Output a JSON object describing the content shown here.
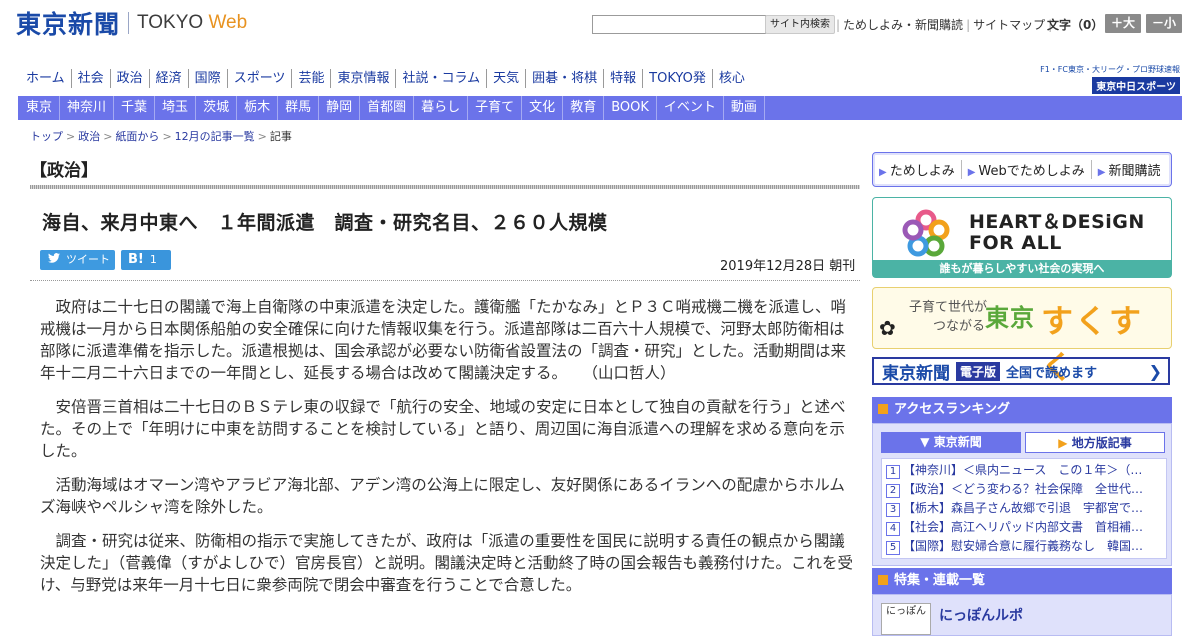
{
  "header": {
    "logo_jp": "東京新聞",
    "logo_en_a": "TOKYO ",
    "logo_en_b": "Web",
    "search_button": "サイト内検索",
    "links": [
      "ためしよみ・新聞購読",
      "サイトマップ"
    ],
    "font_size_label": "文字（0）",
    "font_bigger": "＋大",
    "font_smaller": "－小"
  },
  "global_nav": [
    "ホーム",
    "社会",
    "政治",
    "経済",
    "国際",
    "スポーツ",
    "芸能",
    "東京情報",
    "社説・コラム",
    "天気",
    "囲碁・将棋",
    "特報",
    "TOKYO発",
    "核心"
  ],
  "chunichi": {
    "small": "F1・FC東京・大リーグ・プロ野球速報",
    "big": "東京中日スポーツ"
  },
  "local_nav": [
    "東京",
    "神奈川",
    "千葉",
    "埼玉",
    "茨城",
    "栃木",
    "群馬",
    "静岡",
    "首都圏",
    "暮らし",
    "子育て",
    "文化",
    "教育",
    "BOOK",
    "イベント",
    "動画"
  ],
  "breadcrumb": [
    "トップ",
    "政治",
    "紙面から",
    "12月の記事一覧",
    "記事"
  ],
  "article": {
    "category": "【政治】",
    "headline": "海自、来月中東へ　１年間派遣　調査・研究名目、２６０人規模",
    "tweet_label": "ツイート",
    "hatena_icon": "B!",
    "hatena_count": "1",
    "date": "2019年12月28日 朝刊",
    "paragraphs": [
      "政府は二十七日の閣議で海上自衛隊の中東派遣を決定した。護衛艦「たかなみ」とＰ３Ｃ哨戒機二機を派遣し、哨戒機は一月から日本関係船舶の安全確保に向けた情報収集を行う。派遣部隊は二百六十人規模で、河野太郎防衛相は部隊に派遣準備を指示した。派遣根拠は、国会承認が必要ない防衛省設置法の「調査・研究」とした。活動期間は来年十二月二十六日までの一年間とし、延長する場合は改めて閣議決定する。　　（山口哲人）",
      "安倍晋三首相は二十七日のＢＳテレ東の収録で「航行の安全、地域の安定に日本として独自の貢献を行う」と述べた。その上で「年明けに中東を訪問することを検討している」と語り、周辺国に海自派遣への理解を求める意向を示した。",
      "活動海域はオマーン湾やアラビア海北部、アデン湾の公海上に限定し、友好関係にあるイランへの配慮からホルムズ海峡やペルシャ湾を除外した。",
      "調査・研究は従来、防衛相の指示で実施してきたが、政府は「派遣の重要性を国民に説明する責任の観点から閣議決定した」（菅義偉（すがよしひで）官房長官）と説明。閣議決定時と活動終了時の国会報告も義務付けた。これを受け、与野党は来年一月十七日に衆参両院で閉会中審査を行うことで合意した。"
    ]
  },
  "sidebar": {
    "trial_links": [
      "ためしよみ",
      "Webでためしよみ",
      "新聞購読"
    ],
    "heart_line1": "HEART＆DESiGN",
    "heart_line2": "FOR ALL",
    "heart_footer": "誰もが暮らしやすい社会の実現へ",
    "sukusuku_1": "子育て世代が",
    "sukusuku_2": "つながる",
    "sukusuku_3": "東京",
    "sukusuku_4": "すくすく",
    "denshi_a": "東京新聞",
    "denshi_b": "電子版",
    "denshi_c": "全国で読めます",
    "ranking_title": "アクセスランキング",
    "ranking_tab1": "東京新聞",
    "ranking_tab2": "地方版記事",
    "ranking": [
      {
        "n": "1",
        "t": "【神奈川】＜県内ニュース　この１年＞（…"
      },
      {
        "n": "2",
        "t": "【政治】＜どう変わる？社会保障　全世代…"
      },
      {
        "n": "3",
        "t": "【栃木】森昌子さん故郷で引退　宇都宮で…"
      },
      {
        "n": "4",
        "t": "【社会】高江ヘリパッド内部文書　首相補…"
      },
      {
        "n": "5",
        "t": "【国際】慰安婦合意に履行義務なし　韓国…"
      }
    ],
    "feature_title": "特集・連載一覧",
    "feature_thumb": "にっぽん",
    "feature_item": "にっぽんルポ"
  }
}
